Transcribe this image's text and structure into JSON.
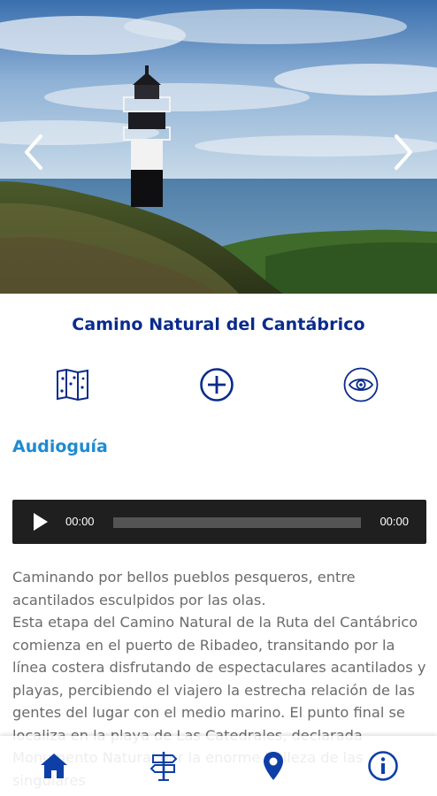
{
  "hero": {
    "image_description_icon": "lighthouse-photo",
    "prev_icon": "chevron-left-icon",
    "next_icon": "chevron-right-icon"
  },
  "title": "Camino Natural del Cantábrico",
  "actions": [
    {
      "icon": "map-icon"
    },
    {
      "icon": "plus-circle-icon"
    },
    {
      "icon": "eye-icon"
    }
  ],
  "audio": {
    "section_title": "Audioguía",
    "current_time": "00:00",
    "total_time": "00:00",
    "progress": 0
  },
  "description": {
    "paragraph1": "Caminando por bellos pueblos pesqueros, entre acantilados esculpidos por las olas.",
    "paragraph2": "Esta etapa del Camino Natural de la Ruta del Cantábrico comienza en el puerto de Ribadeo, transitando por la línea costera disfrutando de espectaculares acantilados y playas, percibiendo el viajero la estrecha relación de las gentes del lugar con el medio marino. El punto final se localiza en la playa de Las Catedrales, declarada Monumento Natural por la enorme belleza de las singulares"
  },
  "bottom_nav": [
    {
      "icon": "home-icon"
    },
    {
      "icon": "signpost-icon"
    },
    {
      "icon": "location-pin-icon"
    },
    {
      "icon": "info-icon"
    }
  ],
  "colors": {
    "title": "#0a2b8c",
    "accent": "#1f8bd1",
    "icon_blue": "#0a2b8c",
    "nav_blue": "#0d3fa6"
  }
}
